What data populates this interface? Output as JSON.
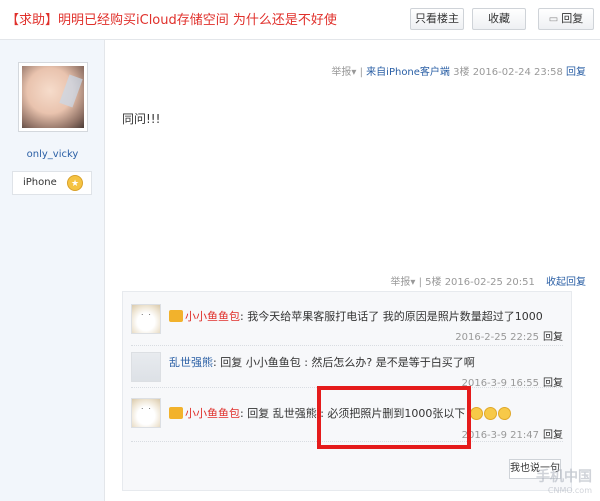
{
  "header": {
    "title": "【求助】明明已经购买iCloud存储空间 为什么还是不好使",
    "only_author": "只看楼主",
    "favorite": "收藏",
    "reply": "回复"
  },
  "post": {
    "report": "举报",
    "source": "来自iPhone客户端",
    "floor": "3楼",
    "time": "2016-02-24 23:58",
    "reply": "回复",
    "content": "同问!!!",
    "author": {
      "username": "only_vicky",
      "device": "iPhone"
    }
  },
  "reply_meta": {
    "report": "举报",
    "floor": "5楼",
    "time": "2016-02-25 20:51",
    "collapse": "收起回复"
  },
  "comments": [
    {
      "user": "小小鱼鱼包",
      "text": "我今天给苹果客服打电话了 我的原因是照片数量超过了1000",
      "time": "2016-2-25 22:25",
      "reply": "回复"
    },
    {
      "user": "乱世强熊",
      "text": "回复 小小鱼鱼包 : 然后怎么办? 是不是等于白买了啊",
      "time": "2016-3-9 16:55",
      "reply": "回复"
    },
    {
      "user": "小小鱼鱼包",
      "text_prefix": "回复 乱世强熊 :",
      "text": "必须把照片删到1000张以下",
      "time": "2016-3-9 21:47",
      "reply": "回复"
    }
  ],
  "say_button": "我也说一句",
  "watermark": {
    "main": "手机中国",
    "sub": "CNMO.com"
  },
  "colors": {
    "accent_red": "#e0302b",
    "link_blue": "#2a5fa5",
    "highlight": "#e51b1b"
  }
}
